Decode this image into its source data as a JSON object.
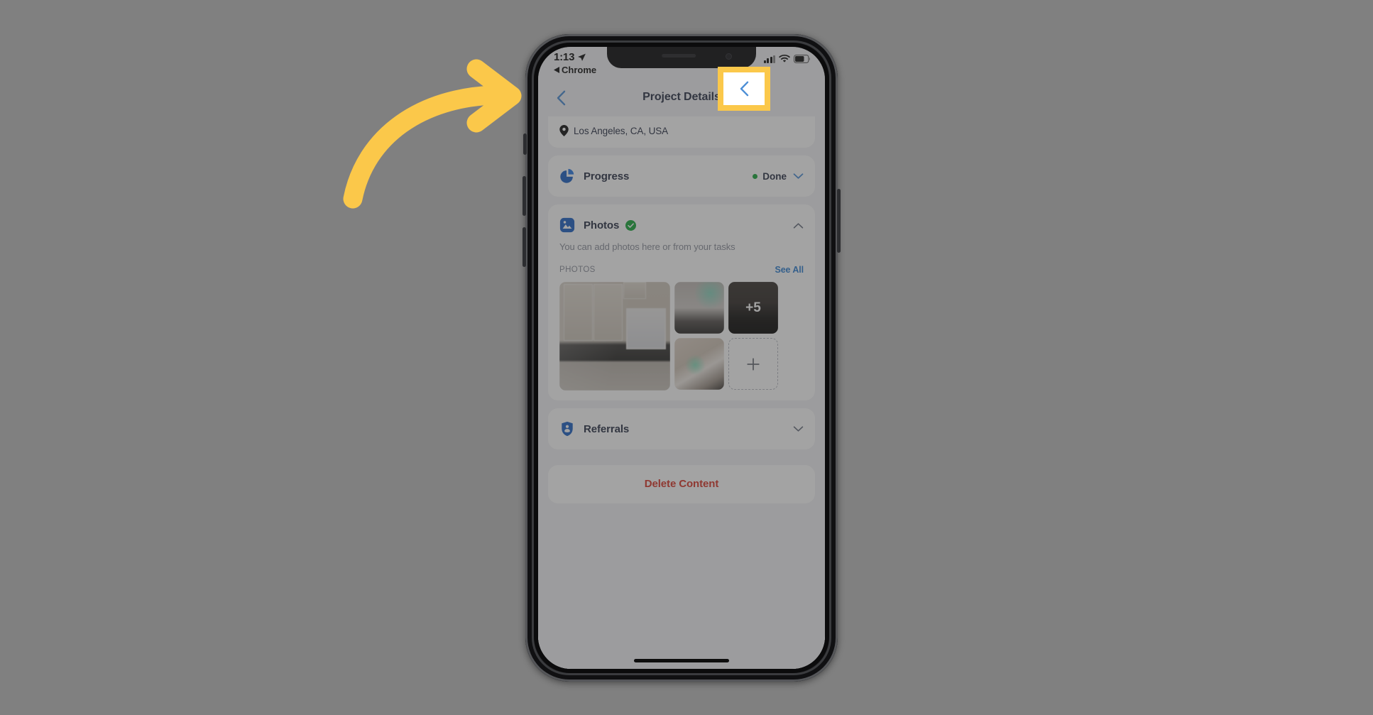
{
  "annotation": {
    "highlight_color": "#FBC84A",
    "arrow_color": "#FBC84A",
    "target": "back-button"
  },
  "status_bar": {
    "time": "1:13",
    "location_icon": "location-arrow-icon",
    "back_app_label": "Chrome",
    "back_app_icon": "triangle-left-icon",
    "signal_icon": "cellular-signal-icon",
    "wifi_icon": "wifi-icon",
    "battery_icon": "battery-icon"
  },
  "nav": {
    "title": "Project Details",
    "back_icon": "chevron-left-icon",
    "back_color": "#4D8FD6"
  },
  "location": {
    "pin_icon": "map-pin-icon",
    "text": "Los Angeles, CA, USA"
  },
  "sections": {
    "progress": {
      "icon": "pie-chart-icon",
      "title": "Progress",
      "status_label": "Done",
      "status_color": "#1AA83C",
      "chevron": "chevron-down-icon"
    },
    "photos": {
      "icon": "photo-icon",
      "title": "Photos",
      "badge_icon": "check-circle-icon",
      "badge_color": "#1AA83C",
      "chevron": "chevron-up-icon",
      "description": "You can add photos here or from your tasks",
      "list_label": "PHOTOS",
      "see_all_label": "See All",
      "see_all_color": "#2F7FD1",
      "more_count_label": "+5",
      "add_icon": "plus-icon",
      "thumbnails": [
        {
          "name": "kitchen-cabinets-photo"
        },
        {
          "name": "room-window-photo"
        },
        {
          "name": "dark-room-photo"
        },
        {
          "name": "stairway-photo"
        }
      ]
    },
    "referrals": {
      "icon": "referral-badge-icon",
      "title": "Referrals",
      "chevron": "chevron-down-icon"
    }
  },
  "delete": {
    "label": "Delete Content",
    "color": "#D9372B"
  }
}
